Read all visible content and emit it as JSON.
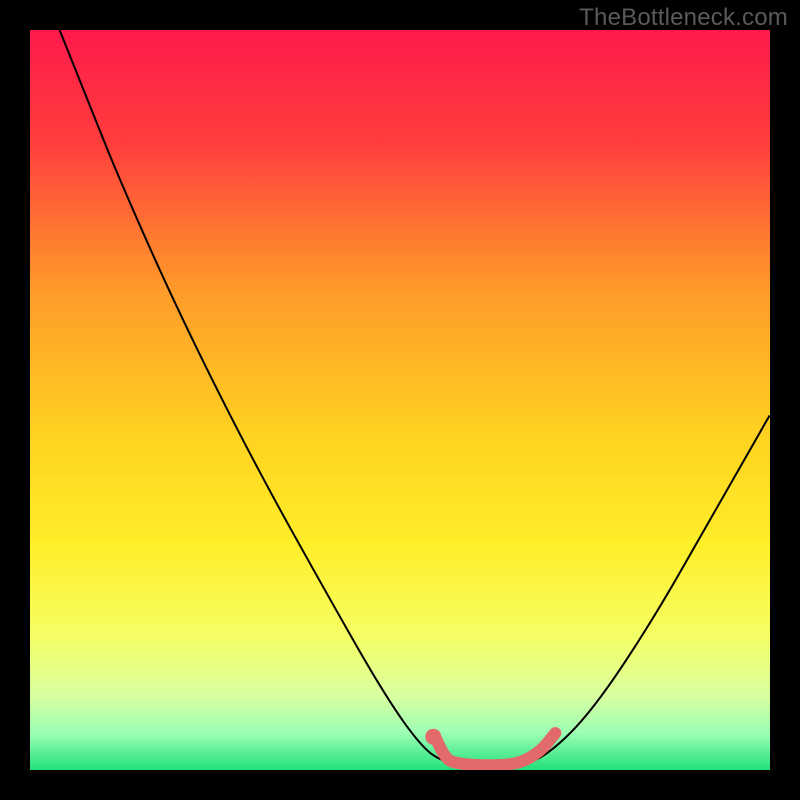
{
  "watermark": "TheBottleneck.com",
  "chart_data": {
    "type": "line",
    "title": "",
    "xlabel": "",
    "ylabel": "",
    "xlim": [
      0,
      100
    ],
    "ylim": [
      0,
      100
    ],
    "background_gradient": {
      "stops": [
        {
          "offset": 0.0,
          "color": "#ff1a4b"
        },
        {
          "offset": 0.15,
          "color": "#ff3d3d"
        },
        {
          "offset": 0.35,
          "color": "#ff9a2a"
        },
        {
          "offset": 0.55,
          "color": "#ffd321"
        },
        {
          "offset": 0.7,
          "color": "#ffef2a"
        },
        {
          "offset": 0.82,
          "color": "#f5ff66"
        },
        {
          "offset": 0.9,
          "color": "#d8ffa0"
        },
        {
          "offset": 0.95,
          "color": "#9dffb4"
        },
        {
          "offset": 1.0,
          "color": "#21e07a"
        }
      ]
    },
    "series": [
      {
        "name": "bottleneck-curve",
        "stroke": "#000000",
        "stroke_width": 2,
        "points": [
          {
            "x": 4,
            "y": 100
          },
          {
            "x": 8,
            "y": 90
          },
          {
            "x": 12,
            "y": 80
          },
          {
            "x": 20,
            "y": 62
          },
          {
            "x": 30,
            "y": 42
          },
          {
            "x": 40,
            "y": 24
          },
          {
            "x": 48,
            "y": 10
          },
          {
            "x": 53,
            "y": 3
          },
          {
            "x": 56,
            "y": 1
          },
          {
            "x": 60,
            "y": 0.5
          },
          {
            "x": 66,
            "y": 0.5
          },
          {
            "x": 70,
            "y": 2
          },
          {
            "x": 76,
            "y": 8
          },
          {
            "x": 84,
            "y": 20
          },
          {
            "x": 92,
            "y": 34
          },
          {
            "x": 100,
            "y": 48
          }
        ]
      },
      {
        "name": "optimal-zone-highlight",
        "stroke": "#e36a6a",
        "stroke_width": 12,
        "linecap": "round",
        "points": [
          {
            "x": 55,
            "y": 4
          },
          {
            "x": 56,
            "y": 1.5
          },
          {
            "x": 58,
            "y": 0.8
          },
          {
            "x": 62,
            "y": 0.6
          },
          {
            "x": 66,
            "y": 0.8
          },
          {
            "x": 69,
            "y": 2.5
          },
          {
            "x": 71,
            "y": 5
          }
        ]
      },
      {
        "name": "marker-dot",
        "type": "scatter",
        "fill": "#e36a6a",
        "radius": 8,
        "points": [
          {
            "x": 54.5,
            "y": 4.5
          }
        ]
      }
    ]
  }
}
